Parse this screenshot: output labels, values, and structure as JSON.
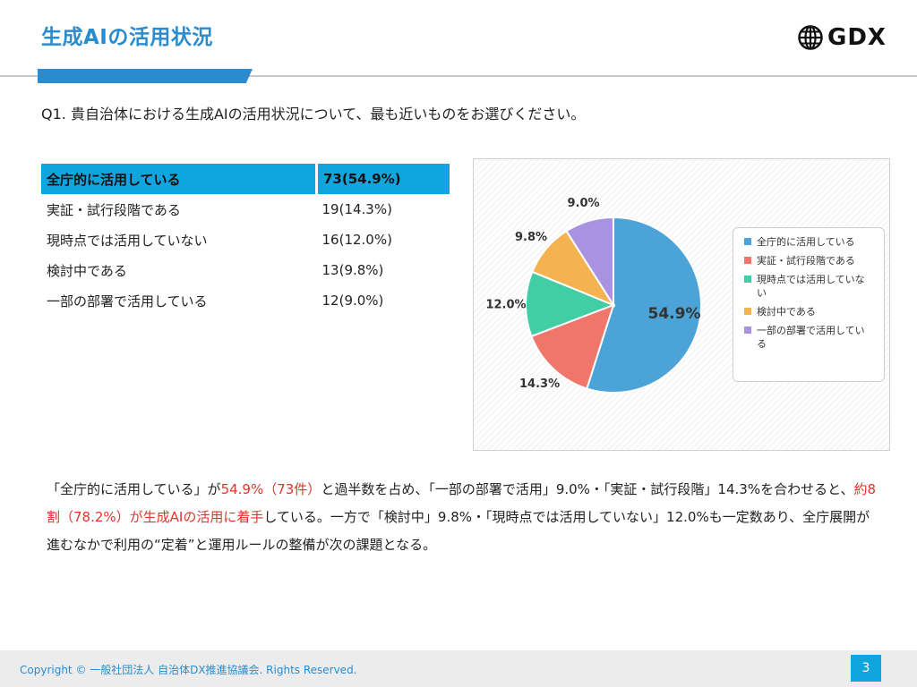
{
  "header": {
    "title": "生成AIの活用状況",
    "logo_text": "GDX"
  },
  "question": "Q1. 貴自治体における生成AIの活用状況について、最も近いものをお選びください。",
  "table": {
    "rows": [
      {
        "label": "全庁的に活用している",
        "value": "73(54.9%)",
        "highlight": true
      },
      {
        "label": "実証・試行段階である",
        "value": "19(14.3%)"
      },
      {
        "label": "現時点では活用していない",
        "value": "16(12.0%)"
      },
      {
        "label": "検討中である",
        "value": "13(9.8%)"
      },
      {
        "label": "一部の部署で活用している",
        "value": "12(9.0%)"
      }
    ]
  },
  "chart_data": {
    "type": "pie",
    "categories": [
      "全庁的に活用している",
      "実証・試行段階である",
      "現時点では活用していない",
      "検討中である",
      "一部の部署で活用している"
    ],
    "legend_labels": [
      [
        "全庁的に活用している"
      ],
      [
        "実証・試行段階である"
      ],
      [
        "現時点では活用していな",
        "い"
      ],
      [
        "検討中である"
      ],
      [
        "一部の部署で活用してい",
        "る"
      ]
    ],
    "values": [
      54.9,
      14.3,
      12.0,
      9.8,
      9.0
    ],
    "data_labels": [
      "54.9%",
      "14.3%",
      "12.0%",
      "9.8%",
      "9.0%"
    ],
    "colors": [
      "#4ba3d8",
      "#f0766c",
      "#41ceA4",
      "#f4b350",
      "#a993e0"
    ],
    "legend_position": "right"
  },
  "summary": {
    "p1": "「全庁的に活用している」が",
    "r1": "54.9%（73件）",
    "p2": "と過半数を占め、「一部の部署で活用」9.0%・「実証・試行段階」14.3%を合わせると、",
    "r2": "約8割（78.2%）が生成AIの活用に着手",
    "p3": "している。一方で「検討中」9.8%・「現時点では活用していない」12.0%も一定数あり、全庁展開が進むなかで利用の“定着”と運用ルールの整備が次の課題となる。"
  },
  "footer": {
    "copyright": "Copyright © 一般社団法人 自治体DX推進協議会. Rights Reserved.",
    "page_number": "3"
  }
}
